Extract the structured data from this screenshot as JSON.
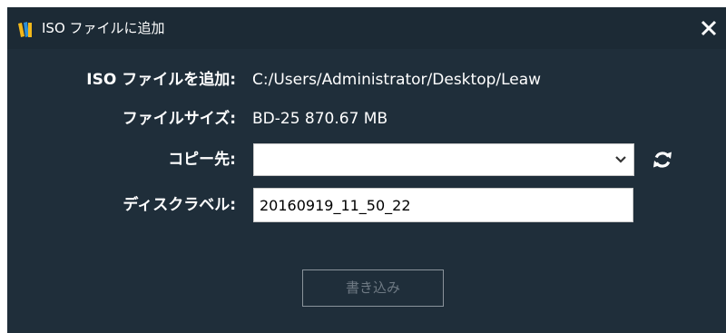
{
  "window": {
    "title": "ISO ファイルに追加",
    "icons": {
      "app": "books-icon",
      "close": "close-icon"
    }
  },
  "form": {
    "iso_file": {
      "label": "ISO ファイルを追加:",
      "value": "C:/Users/Administrator/Desktop/Leaw"
    },
    "file_size": {
      "label": "ファイルサイズ:",
      "value": "BD-25 870.67 MB"
    },
    "copy_to": {
      "label": "コピー先:",
      "selected": ""
    },
    "disc_label": {
      "label": "ディスクラベル:",
      "value": "20160919_11_50_22"
    },
    "write_button": {
      "label": "書き込み",
      "enabled": false
    }
  },
  "colors": {
    "background": "#1f2e3a",
    "text": "#ffffff",
    "disabled_text": "#6f7a84",
    "app_icon_yellow": "#f2b81b",
    "app_icon_blue": "#2d8fd6"
  }
}
